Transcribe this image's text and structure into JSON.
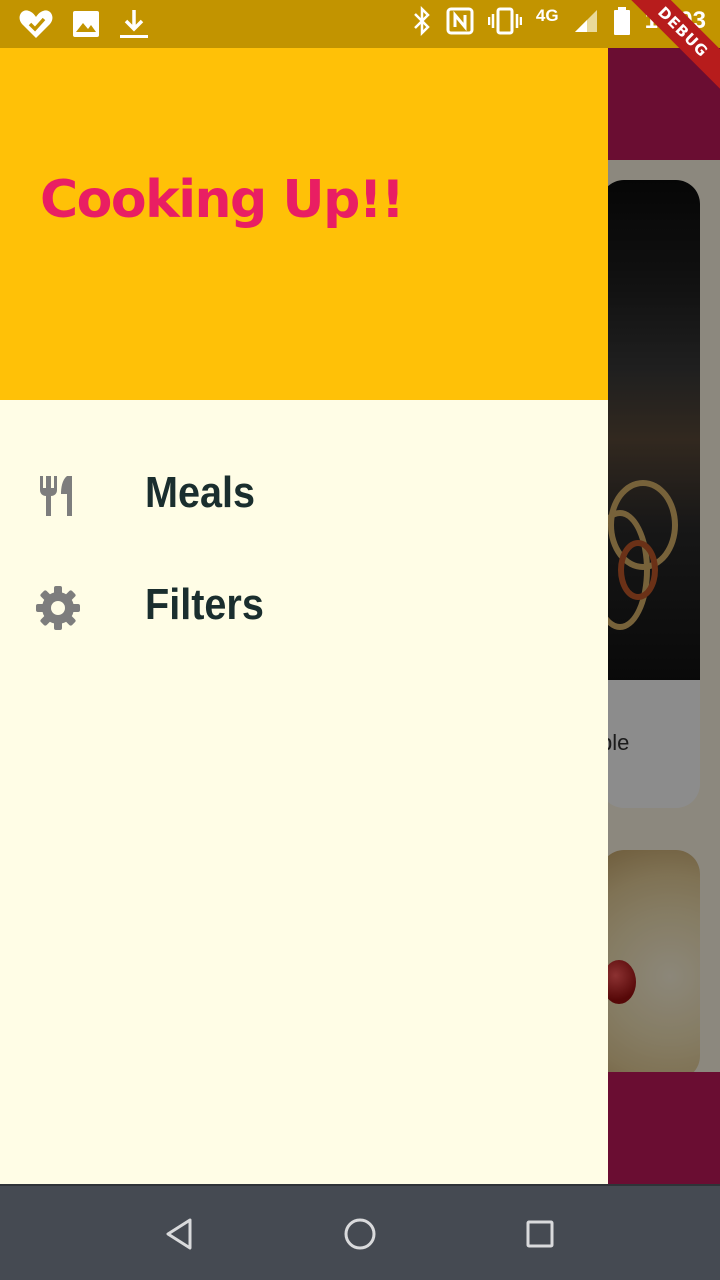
{
  "status_bar": {
    "time": "12:03",
    "network": "4G",
    "debug_banner": "DEBUG",
    "icons_left": [
      "heart-check-icon",
      "image-icon",
      "download-icon"
    ],
    "icons_right": [
      "bluetooth-icon",
      "nfc-icon",
      "vibrate-icon",
      "signal-icon",
      "battery-icon"
    ]
  },
  "drawer": {
    "title": "Cooking Up!!",
    "items": [
      {
        "label": "Meals",
        "icon": "restaurant-icon"
      },
      {
        "label": "Filters",
        "icon": "gear-icon"
      }
    ]
  },
  "background": {
    "visible_text": "ble"
  },
  "nav_bar": {
    "buttons": [
      "back-button",
      "home-button",
      "recents-button"
    ]
  },
  "colors": {
    "status_bar": "#c29400",
    "drawer_header": "#ffc107",
    "drawer_title": "#e91e63",
    "drawer_body": "#fffde6",
    "menu_text": "#1a2e2e",
    "menu_icon": "#7d7d7d",
    "app_bar": "#c2185b",
    "nav_bar": "#454a52"
  }
}
